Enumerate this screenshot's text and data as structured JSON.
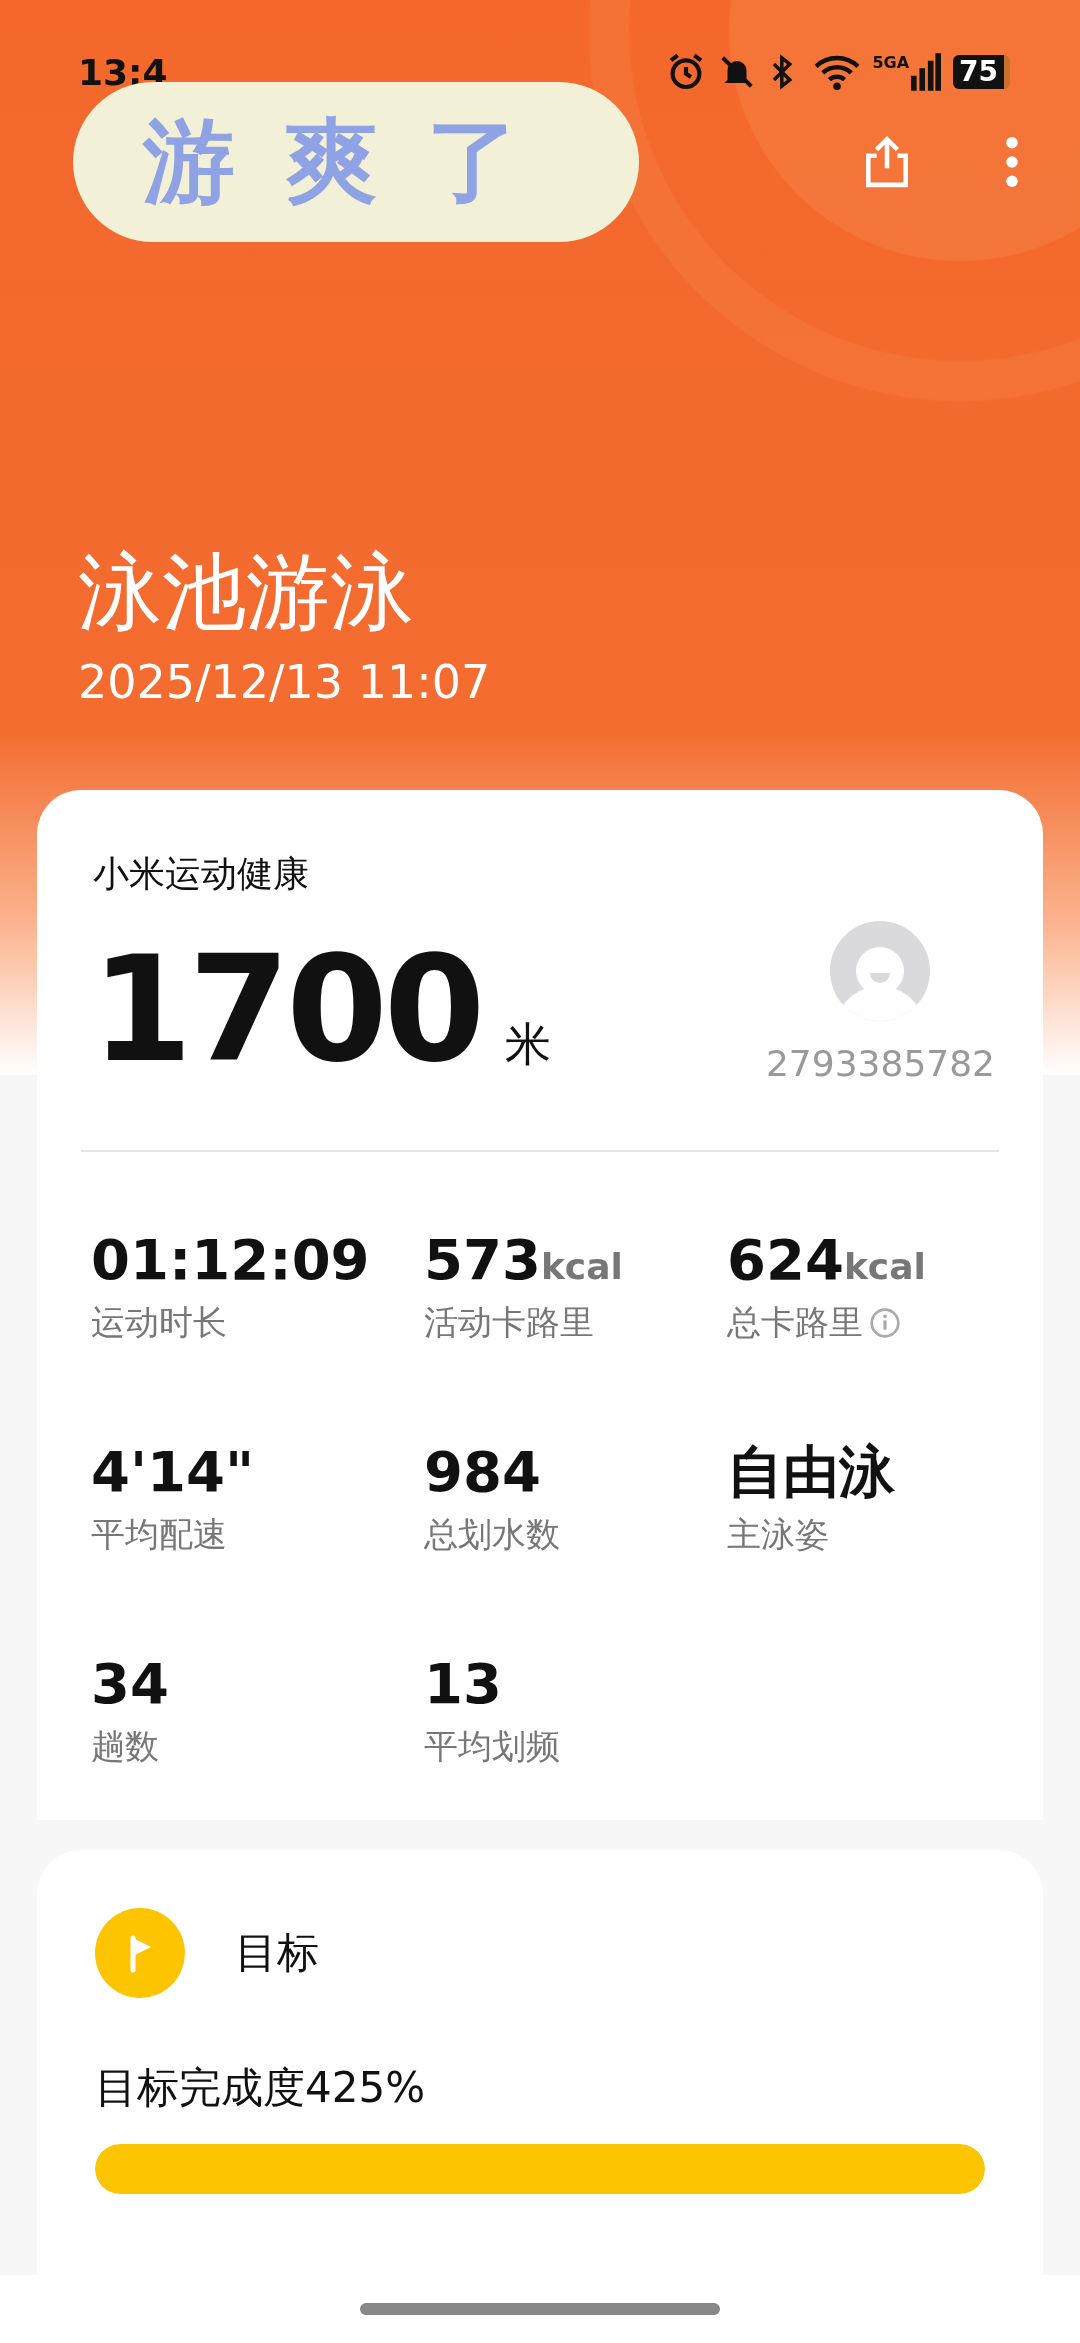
{
  "status_bar": {
    "time": "13:4",
    "network": "5GA",
    "battery": "75"
  },
  "sticker": {
    "text": "游爽了"
  },
  "header": {
    "title": "泳池游泳",
    "datetime": "2025/12/13 11:07"
  },
  "summary": {
    "app_name": "小米运动健康",
    "distance": "1700",
    "unit": "米",
    "user_id": "2793385782"
  },
  "stats": [
    {
      "value": "01:12:09",
      "label": "运动时长",
      "info": false
    },
    {
      "value": "573",
      "unit": "kcal",
      "label": "活动卡路里",
      "info": false
    },
    {
      "value": "624",
      "unit": "kcal",
      "label": "总卡路里",
      "info": true
    },
    {
      "value": "4'14\"",
      "label": "平均配速",
      "info": false
    },
    {
      "value": "984",
      "label": "总划水数",
      "info": false
    },
    {
      "value": "自由泳",
      "label": "主泳姿",
      "info": false
    },
    {
      "value": "34",
      "label": "趟数",
      "info": false
    },
    {
      "value": "13",
      "label": "平均划频",
      "info": false
    }
  ],
  "goal": {
    "title": "目标",
    "progress_text": "目标完成度425%",
    "level": 1
  }
}
